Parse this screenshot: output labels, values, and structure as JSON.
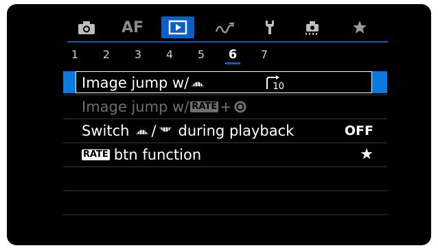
{
  "tabs": [
    {
      "name": "camera",
      "icon": "camera-icon"
    },
    {
      "name": "af",
      "label": "AF"
    },
    {
      "name": "playback",
      "icon": "playback-icon",
      "active": true
    },
    {
      "name": "wireless",
      "icon": "wireless-icon"
    },
    {
      "name": "setup",
      "icon": "wrench-icon"
    },
    {
      "name": "custom",
      "icon": "custom-function-icon"
    },
    {
      "name": "mymenu",
      "icon": "star-icon"
    }
  ],
  "pages": [
    "1",
    "2",
    "3",
    "4",
    "5",
    "6",
    "7"
  ],
  "active_page": "6",
  "menu": {
    "row1_label": "Image jump w/",
    "row1_value_icon": "jump-10-icon",
    "row1_value_sub": "10",
    "row2_label": "Image jump w/",
    "row2_badge": "RATE",
    "row2_plus": "+",
    "row3_label_a": "Switch",
    "row3_sep": "/",
    "row3_label_b": "during playback",
    "row3_value": "OFF",
    "row4_badge": "RATE",
    "row4_label": "btn function",
    "row4_value": "★"
  },
  "colors": {
    "accent": "#0a5fc6",
    "selection": "#0a7ae0",
    "disabled": "#6f6f6f",
    "background": "#000000"
  }
}
